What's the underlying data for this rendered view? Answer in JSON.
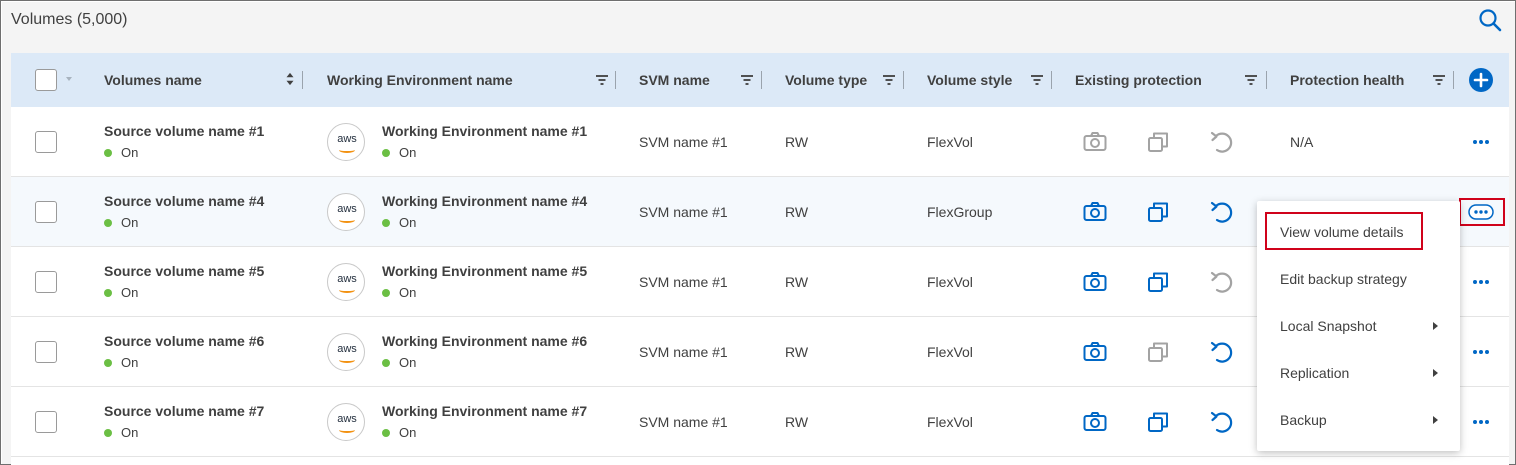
{
  "title": "Volumes (5,000)",
  "columns": [
    {
      "key": "name",
      "label": "Volumes name"
    },
    {
      "key": "we",
      "label": "Working Environment name"
    },
    {
      "key": "svm",
      "label": "SVM name"
    },
    {
      "key": "type",
      "label": "Volume type"
    },
    {
      "key": "style",
      "label": "Volume style"
    },
    {
      "key": "protection",
      "label": "Existing protection"
    },
    {
      "key": "health",
      "label": "Protection health"
    }
  ],
  "aws_label": "aws",
  "rows": [
    {
      "name": "Source volume name #1",
      "status": "On",
      "we": "Working Environment name #1",
      "we_status": "On",
      "svm": "SVM name #1",
      "type": "RW",
      "style": "FlexVol",
      "health": "N/A",
      "snapshot_active": false,
      "replication_active": false,
      "backup_active": false
    },
    {
      "name": "Source volume name #4",
      "status": "On",
      "we": "Working Environment name  #4",
      "we_status": "On",
      "svm": "SVM name #1",
      "type": "RW",
      "style": "FlexGroup",
      "health": "",
      "snapshot_active": true,
      "replication_active": true,
      "backup_active": true
    },
    {
      "name": "Source volume name #5",
      "status": "On",
      "we": "Working Environment name  #5",
      "we_status": "On",
      "svm": "SVM name #1",
      "type": "RW",
      "style": "FlexVol",
      "health": "",
      "snapshot_active": true,
      "replication_active": true,
      "backup_active": false
    },
    {
      "name": "Source volume name #6",
      "status": "On",
      "we": "Working Environment name  #6",
      "we_status": "On",
      "svm": "SVM name #1",
      "type": "RW",
      "style": "FlexVol",
      "health": "",
      "snapshot_active": true,
      "replication_active": false,
      "backup_active": true
    },
    {
      "name": "Source volume name #7",
      "status": "On",
      "we": "Working Environment name  #7",
      "we_status": "On",
      "svm": "SVM name #1",
      "type": "RW",
      "style": "FlexVol",
      "health": "",
      "snapshot_active": true,
      "replication_active": true,
      "backup_active": true
    }
  ],
  "context_menu": {
    "items": [
      {
        "label": "View volume details",
        "submenu": false,
        "highlighted": true
      },
      {
        "label": "Edit backup strategy",
        "submenu": false,
        "highlighted": false
      },
      {
        "label": "Local Snapshot",
        "submenu": true,
        "highlighted": false
      },
      {
        "label": "Replication",
        "submenu": true,
        "highlighted": false
      },
      {
        "label": "Backup",
        "submenu": true,
        "highlighted": false
      }
    ]
  },
  "colors": {
    "accent": "#0067c5",
    "inactive_icon": "#a3a3a3",
    "status_on": "#6bbf44",
    "header_bg": "#dce9f7",
    "highlight": "#d0021b"
  },
  "icons": {
    "search": "search-icon",
    "filter": "filter-icon",
    "sort": "sort-icon",
    "add": "add-column-icon",
    "snapshot": "camera-icon",
    "replication": "copy-icon",
    "backup": "restore-icon",
    "more": "more-dots-icon"
  }
}
